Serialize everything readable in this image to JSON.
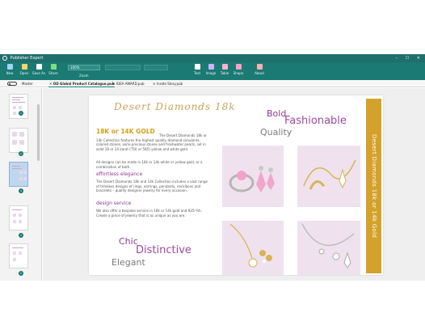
{
  "window": {
    "title": "Publisher Expert",
    "controls": "– ☐ ✕"
  },
  "ribbon": {
    "buttons": [
      {
        "id": "new",
        "label": "New",
        "color": "#9fd3ff"
      },
      {
        "id": "open",
        "label": "Open",
        "color": "#ffd36a"
      },
      {
        "id": "save_as",
        "label": "Save As",
        "color": "#ffffff"
      },
      {
        "id": "share",
        "label": "Share",
        "color": "#7ee07e"
      },
      {
        "id": "text",
        "label": "Text",
        "color": "#ffffff"
      },
      {
        "id": "image",
        "label": "Image",
        "color": "#c9b4ff"
      },
      {
        "id": "table",
        "label": "Table",
        "color": "#ffb0d0"
      },
      {
        "id": "shape",
        "label": "Shape",
        "color": "#ff9fc4"
      },
      {
        "id": "about",
        "label": "About",
        "color": "#ffb0b0"
      }
    ],
    "zoom_value": "100%",
    "zoom_label": "Zoom"
  },
  "tabbar": {
    "master_label": "Master",
    "tabs": [
      {
        "label": "DD Global Product Catalogue.pub",
        "active": true
      },
      {
        "label": "IDEA AWARD.pub",
        "active": false
      },
      {
        "label": "Inside Story.pub",
        "active": false
      }
    ]
  },
  "pages": {
    "numbers": [
      "1",
      "2",
      "3",
      "4",
      "5"
    ],
    "selected": "3"
  },
  "document": {
    "heading": "Desert Diamonds 18k",
    "gold_heading": "18K or 14K GOLD",
    "intro": "The Desert Diamonds 18k or 14k Collection features the highest quality diamond simulants, colored stones, semi-precious stones and freshwater pearls, set in solid 18 or 14 karat (750 or 585) yellow and white gold.",
    "para2": "All designs can be made in 18k or 14k white or yellow gold, or a combination of both.",
    "sub1": "effortless elegance",
    "para3": "The Desert Diamonds 18k and 14k Collection includes a vast range of timeless designs of rings, earrings, pendants, necklaces and bracelets – quality designer jewelry for every occasion.",
    "sub2": "design service",
    "para4": "We also offer a bespoke service in 18k or 14k gold and 925/ Rh. Create a piece of jewelry that is as unique as you are.",
    "words": {
      "bold": "Bold",
      "fashionable": "Fashionable",
      "quality": "Quality",
      "chic": "Chic",
      "distinctive": "Distinctive",
      "elegant": "Elegant"
    },
    "band_text": "Desert Diamonds 18k or 14k Gold",
    "colors": {
      "gold": "#d4a12b",
      "purple": "#8a3d8f",
      "grey": "#7a7a7a"
    }
  }
}
